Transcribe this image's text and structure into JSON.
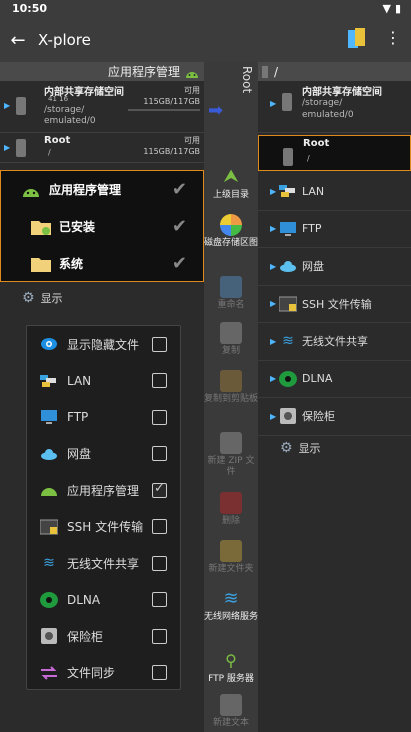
{
  "status": {
    "time": "10:50"
  },
  "appbar": {
    "title": "X-plore"
  },
  "left": {
    "header": "应用程序管理",
    "storage": {
      "name": "内部共享存储空间",
      "counts": "41  16",
      "path1": "/storage/",
      "path2": "emulated/0",
      "available": "可用",
      "size": "115GB/117GB"
    },
    "root": {
      "name": "Root",
      "path": "/",
      "available": "可用",
      "size": "115GB/117GB"
    },
    "apps": [
      {
        "label": "应用程序管理"
      },
      {
        "label": "已安装"
      },
      {
        "label": "系统"
      }
    ],
    "show_label": "显示"
  },
  "popup": {
    "items": [
      {
        "label": "显示隐藏文件",
        "checked": false,
        "icon": "eye-icon"
      },
      {
        "label": "LAN",
        "checked": false,
        "icon": "lan-icon"
      },
      {
        "label": "FTP",
        "checked": false,
        "icon": "ftp-icon"
      },
      {
        "label": "网盘",
        "checked": false,
        "icon": "cloud-icon"
      },
      {
        "label": "应用程序管理",
        "checked": true,
        "icon": "android-icon"
      },
      {
        "label": "SSH 文件传输",
        "checked": false,
        "icon": "ssh-icon"
      },
      {
        "label": "无线文件共享",
        "checked": false,
        "icon": "wifi-icon"
      },
      {
        "label": "DLNA",
        "checked": false,
        "icon": "dlna-icon"
      },
      {
        "label": "保险柜",
        "checked": false,
        "icon": "vault-icon"
      },
      {
        "label": "文件同步",
        "checked": false,
        "icon": "sync-icon"
      }
    ]
  },
  "mid": {
    "rootlabel": "Root",
    "tools": [
      {
        "label": "上级目录",
        "dim": false
      },
      {
        "label": "磁盘存储区图",
        "dim": false
      },
      {
        "label": "重命名",
        "dim": true
      },
      {
        "label": "复制",
        "dim": true
      },
      {
        "label": "复制到剪贴板",
        "dim": true
      },
      {
        "label": "新建 ZIP 文件",
        "dim": true
      },
      {
        "label": "删除",
        "dim": true
      },
      {
        "label": "新建文件夹",
        "dim": true
      },
      {
        "label": "无线网络服务",
        "dim": false
      },
      {
        "label": "FTP 服务器",
        "dim": false
      },
      {
        "label": "新建文本",
        "dim": true
      }
    ]
  },
  "right": {
    "header": "/",
    "storage": {
      "name": "内部共享存储空间",
      "path1": "/storage/",
      "path2": "emulated/0"
    },
    "root": {
      "name": "Root",
      "path": "/"
    },
    "items": [
      {
        "label": "LAN",
        "icon": "lan-icon"
      },
      {
        "label": "FTP",
        "icon": "ftp-icon"
      },
      {
        "label": "网盘",
        "icon": "cloud-icon"
      },
      {
        "label": "SSH 文件传输",
        "icon": "ssh-icon"
      },
      {
        "label": "无线文件共享",
        "icon": "wifi-icon"
      },
      {
        "label": "DLNA",
        "icon": "dlna-icon"
      },
      {
        "label": "保险柜",
        "icon": "vault-icon"
      }
    ],
    "show_label": "显示"
  }
}
